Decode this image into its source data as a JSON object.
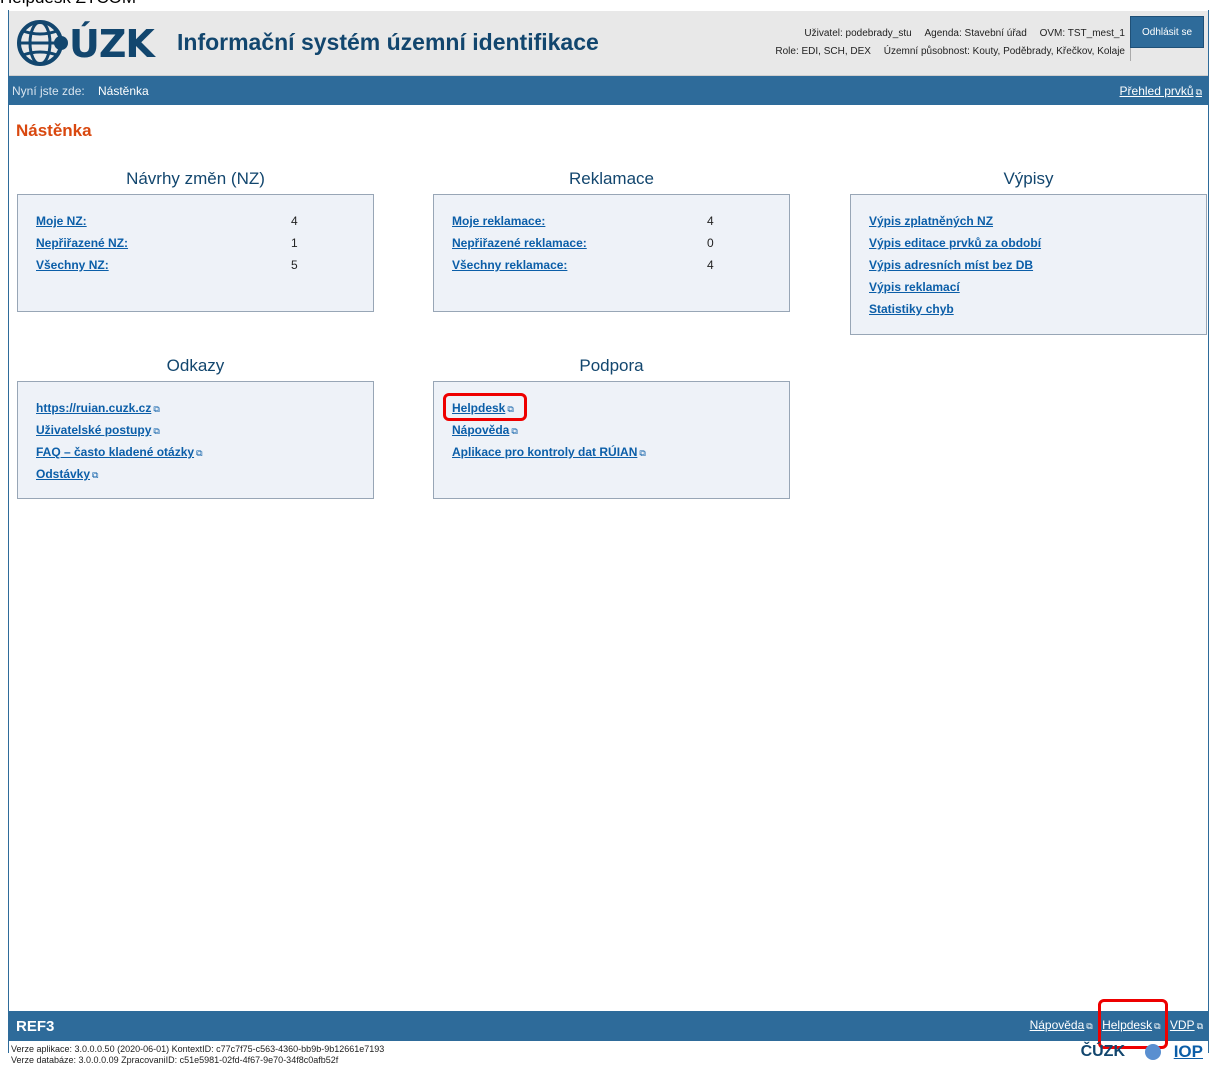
{
  "doc_snippet": "Helpdesk ZTCOM",
  "header": {
    "app_title": "Informační systém územní identifikace",
    "logo_text": "ÚZK",
    "user_label": "Uživatel: podebrady_stu",
    "agenda_label": "Agenda: Stavební úřad",
    "ovm_label": "OVM: TST_mest_1",
    "role_label": "Role: EDI, SCH, DEX",
    "territory_label": "Územní působnost: Kouty, Poděbrady, Křečkov, Kolaje",
    "logout_label": "Odhlásit se"
  },
  "breadcrumb": {
    "prefix": "Nyní jste zde:",
    "current": "Nástěnka",
    "overview_link": "Přehled prvků"
  },
  "page_title": "Nástěnka",
  "panels": {
    "nz": {
      "title": "Návrhy změn (NZ)",
      "rows": [
        {
          "label": "Moje NZ:",
          "count": "4"
        },
        {
          "label": "Nepřiřazené NZ:",
          "count": "1"
        },
        {
          "label": "Všechny NZ:",
          "count": "5"
        }
      ]
    },
    "reklamace": {
      "title": "Reklamace",
      "rows": [
        {
          "label": "Moje reklamace:",
          "count": "4"
        },
        {
          "label": "Nepřiřazené reklamace:",
          "count": "0"
        },
        {
          "label": "Všechny reklamace:",
          "count": "4"
        }
      ]
    },
    "vypisy": {
      "title": "Výpisy",
      "links": [
        "Výpis zplatněných NZ",
        "Výpis editace prvků za období",
        "Výpis adresních míst bez DB",
        "Výpis reklamací",
        "Statistiky chyb"
      ]
    },
    "odkazy": {
      "title": "Odkazy",
      "links": [
        "https://ruian.cuzk.cz",
        "Uživatelské postupy",
        "FAQ – často kladené otázky",
        "Odstávky"
      ]
    },
    "podpora": {
      "title": "Podpora",
      "links": [
        "Helpdesk",
        "Nápověda",
        "Aplikace pro kontroly dat RÚIAN"
      ]
    }
  },
  "footer": {
    "env": "REF3",
    "links": [
      "Nápověda",
      "Helpdesk",
      "VDP"
    ],
    "version_app": "Verze aplikace: 3.0.0.0.50 (2020-06-01) KontextID: c77c7f75-c563-4360-bb9b-9b12661e7193",
    "version_db": "Verze databáze: 3.0.0.0.09 ZpracovaniID: c51e5981-02fd-4f67-9e70-34f8c0afb52f",
    "logo_cuzk": "ČÚZK",
    "logo_iop": "IOP"
  },
  "colors": {
    "bar": "#2e6b9a",
    "title_orange": "#d9480f",
    "panel_bg": "#eef2f8",
    "highlight_red": "#e00000"
  },
  "icons": {
    "external_link": "external-link-icon"
  }
}
